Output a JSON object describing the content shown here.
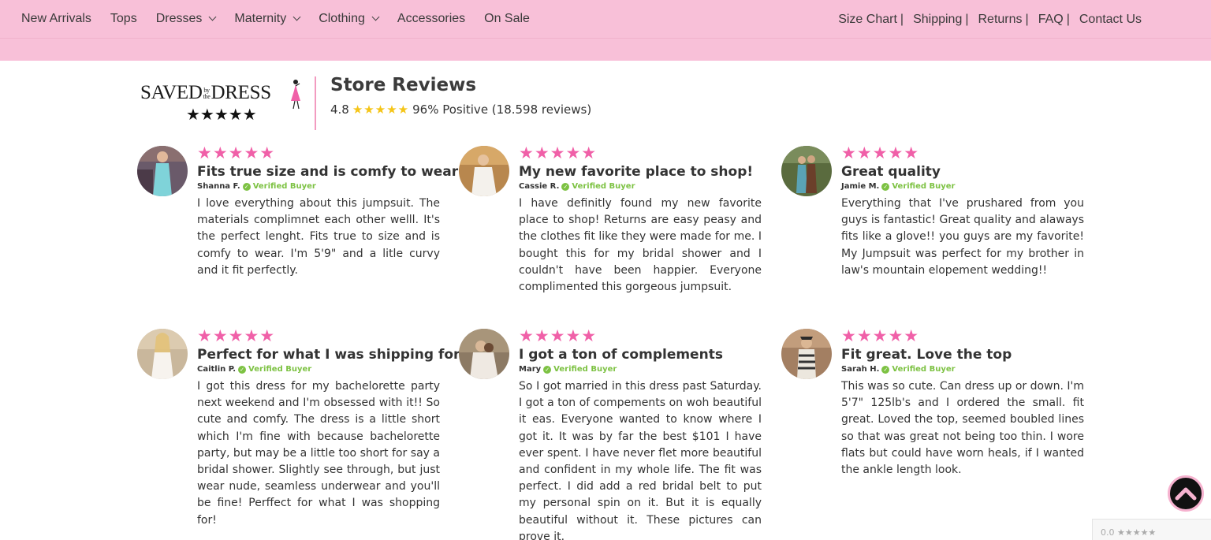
{
  "nav": {
    "left": [
      {
        "label": "New Arrivals",
        "dropdown": false
      },
      {
        "label": "Tops",
        "dropdown": false
      },
      {
        "label": "Dresses",
        "dropdown": true
      },
      {
        "label": "Maternity",
        "dropdown": true
      },
      {
        "label": "Clothing",
        "dropdown": true
      },
      {
        "label": "Accessories",
        "dropdown": false
      },
      {
        "label": "On Sale",
        "dropdown": false
      }
    ],
    "right": [
      "Size Chart",
      "Shipping",
      "Returns",
      "FAQ",
      "Contact Us"
    ],
    "separator": "|"
  },
  "brand": {
    "logo_saved": "SAVED",
    "logo_by": "by",
    "logo_the": "the",
    "logo_dress": "DRESS",
    "logo_stars": "★★★★★"
  },
  "header": {
    "title": "Store Reviews",
    "rating": "4.8",
    "stars": "★★★★★",
    "summary": "96% Positive (18.598 reviews)"
  },
  "reviews": [
    {
      "stars": "★★★★★",
      "title": "Fits true size and is comfy to wear",
      "author": "Shanna F.",
      "verified": "Verified Buyer",
      "text": "I love everything about this jumpsuit. The materials complimnet each other welll. It's the perfect lenght. Fits true to size and is comfy to wear. I'm 5'9\" and a litle curvy and it fit perfectly."
    },
    {
      "stars": "★★★★★",
      "title": "My new favorite place to shop!",
      "author": "Cassie R.",
      "verified": "Verified Buyer",
      "text": "I have definitly found my new favorite place to shop! Returns are easy peasy and the clothes fit like they were made for me. I bought this for my bridal shower and I couldn't have been happier. Everyone complimented this gorgeous jumpsuit."
    },
    {
      "stars": "★★★★★",
      "title": "Great quality",
      "author": "Jamie M.",
      "verified": "Verified Buyer",
      "text": "Everything that I've prushared from you guys is fantastic! Great quality and alaways fits like a glove!! you guys are my favorite! My Jumpsuit was perfect for my brother in law's mountain elopement wedding!!"
    },
    {
      "stars": "★★★★★",
      "title": "Perfect for what I was shipping for!",
      "author": "Caitlin P.",
      "verified": "Verified Buyer",
      "text": "I got this dress for my bachelorette party next weekend and I'm obsessed with it!! So cute and comfy. The dress is a little short which I'm fine with because bachelorette party, but may be a little too short for say a bridal shower. Slightly see through, but just wear nude, seamless underwear and you'll be fine! Perffect for what I was shopping for!"
    },
    {
      "stars": "★★★★★",
      "title": "I got a ton of complements",
      "author": "Mary",
      "verified": "Verified Buyer",
      "text": "So I got married in this dress past Saturday. I got a ton of compements on woh beautiful it eas. Everyone wanted to know where I got it. It was by far the best $101 I have ever spent. I have never flet more beautiful and confident in my whole life. The fit was perfect. I did add a red bridal belt to put my personal spin on it. But it is equally beautiful without it. These pictures can prove it."
    },
    {
      "stars": "★★★★★",
      "title": "Fit great. Love the top",
      "author": "Sarah H.",
      "verified": "Verified Buyer",
      "text": "This was so cute. Can dress up or down. I'm 5'7\" 125lb's and I ordered the small. fit great. Loved the top, seemed boubled lines so that was great not being too thin. I wore flats but could have worn heals, if I wanted the ankle length look."
    }
  ],
  "corner_badge": "0.0 ★★★★★",
  "colors": {
    "nav_bg": "#f8c0d8",
    "pink_star": "#f060a8",
    "gold_star": "#f5c518",
    "verified_green": "#7dc243",
    "divider_pink": "#f29bc0"
  },
  "icons": {
    "back_to_top": "chevron-up-icon",
    "verified": "check-shield-icon",
    "logo_figure": "dress-figure-icon"
  }
}
